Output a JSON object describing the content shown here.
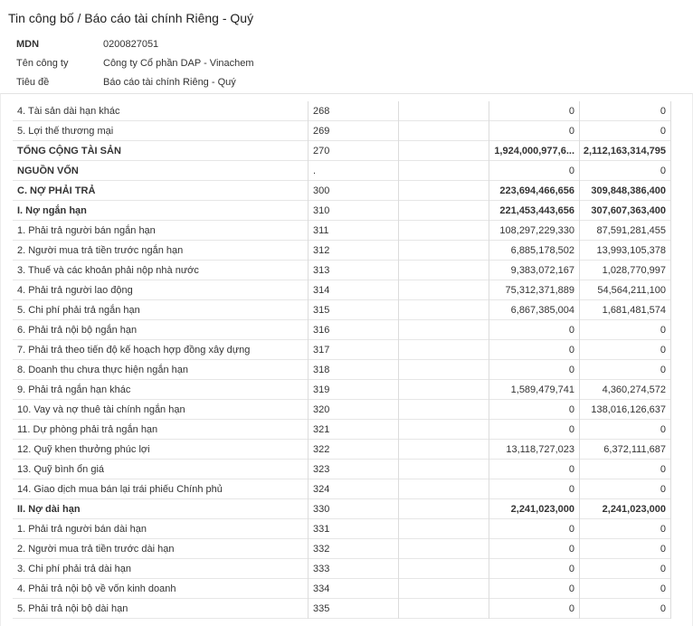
{
  "page_title": "Tin công bố / Báo cáo tài chính Riêng - Quý",
  "meta": [
    {
      "label": "MDN",
      "value": "0200827051"
    },
    {
      "label": "Tên công ty",
      "value": "Công ty Cổ phần DAP - Vinachem"
    },
    {
      "label": "Tiêu đề",
      "value": "Báo cáo tài chính Riêng - Quý"
    }
  ],
  "rows": [
    {
      "name": "4. Tài sản dài hạn khác",
      "code": "268",
      "v1": "0",
      "v2": "0"
    },
    {
      "name": "5. Lợi thế thương mại",
      "code": "269",
      "v1": "0",
      "v2": "0"
    },
    {
      "name": "TỔNG CỘNG TÀI SẢN",
      "code": "270",
      "v1": "1,924,000,977,6...",
      "v2": "2,112,163,314,795"
    },
    {
      "name": "NGUỒN VỐN",
      "code": ".",
      "v1": "0",
      "v2": "0"
    },
    {
      "name": "C. NỢ PHẢI TRẢ",
      "code": "300",
      "v1": "223,694,466,656",
      "v2": "309,848,386,400"
    },
    {
      "name": "I. Nợ ngắn hạn",
      "code": "310",
      "v1": "221,453,443,656",
      "v2": "307,607,363,400"
    },
    {
      "name": "1. Phải trả người bán ngắn hạn",
      "code": "311",
      "v1": "108,297,229,330",
      "v2": "87,591,281,455"
    },
    {
      "name": "2. Người mua trả tiền trước ngắn hạn",
      "code": "312",
      "v1": "6,885,178,502",
      "v2": "13,993,105,378"
    },
    {
      "name": "3. Thuế và các khoản phải nộp nhà nước",
      "code": "313",
      "v1": "9,383,072,167",
      "v2": "1,028,770,997"
    },
    {
      "name": "4. Phải trả người lao động",
      "code": "314",
      "v1": "75,312,371,889",
      "v2": "54,564,211,100"
    },
    {
      "name": "5. Chi phí phải trả ngắn hạn",
      "code": "315",
      "v1": "6,867,385,004",
      "v2": "1,681,481,574"
    },
    {
      "name": "6. Phải trả nội bộ ngắn hạn",
      "code": "316",
      "v1": "0",
      "v2": "0"
    },
    {
      "name": "7. Phải trả theo tiến độ kế hoạch hợp đồng xây dựng",
      "code": "317",
      "v1": "0",
      "v2": "0"
    },
    {
      "name": "8. Doanh thu chưa thực hiện ngắn hạn",
      "code": "318",
      "v1": "0",
      "v2": "0"
    },
    {
      "name": "9. Phải trả ngắn hạn khác",
      "code": "319",
      "v1": "1,589,479,741",
      "v2": "4,360,274,572"
    },
    {
      "name": "10. Vay và nợ thuê tài chính ngắn hạn",
      "code": "320",
      "v1": "0",
      "v2": "138,016,126,637"
    },
    {
      "name": "11. Dự phòng phải trả ngắn hạn",
      "code": "321",
      "v1": "0",
      "v2": "0"
    },
    {
      "name": "12. Quỹ khen thưởng phúc lợi",
      "code": "322",
      "v1": "13,118,727,023",
      "v2": "6,372,111,687"
    },
    {
      "name": "13. Quỹ bình ổn giá",
      "code": "323",
      "v1": "0",
      "v2": "0"
    },
    {
      "name": "14. Giao dịch mua bán lại trái phiếu Chính phủ",
      "code": "324",
      "v1": "0",
      "v2": "0"
    },
    {
      "name": "II. Nợ dài hạn",
      "code": "330",
      "v1": "2,241,023,000",
      "v2": "2,241,023,000"
    },
    {
      "name": "1. Phải trả người bán dài hạn",
      "code": "331",
      "v1": "0",
      "v2": "0"
    },
    {
      "name": "2. Người mua trả tiền trước dài hạn",
      "code": "332",
      "v1": "0",
      "v2": "0"
    },
    {
      "name": "3. Chi phí phải trả dài hạn",
      "code": "333",
      "v1": "0",
      "v2": "0"
    },
    {
      "name": "4. Phải trả nội bộ về vốn kinh doanh",
      "code": "334",
      "v1": "0",
      "v2": "0"
    },
    {
      "name": "5. Phải trả nội bộ dài hạn",
      "code": "335",
      "v1": "0",
      "v2": "0"
    }
  ]
}
